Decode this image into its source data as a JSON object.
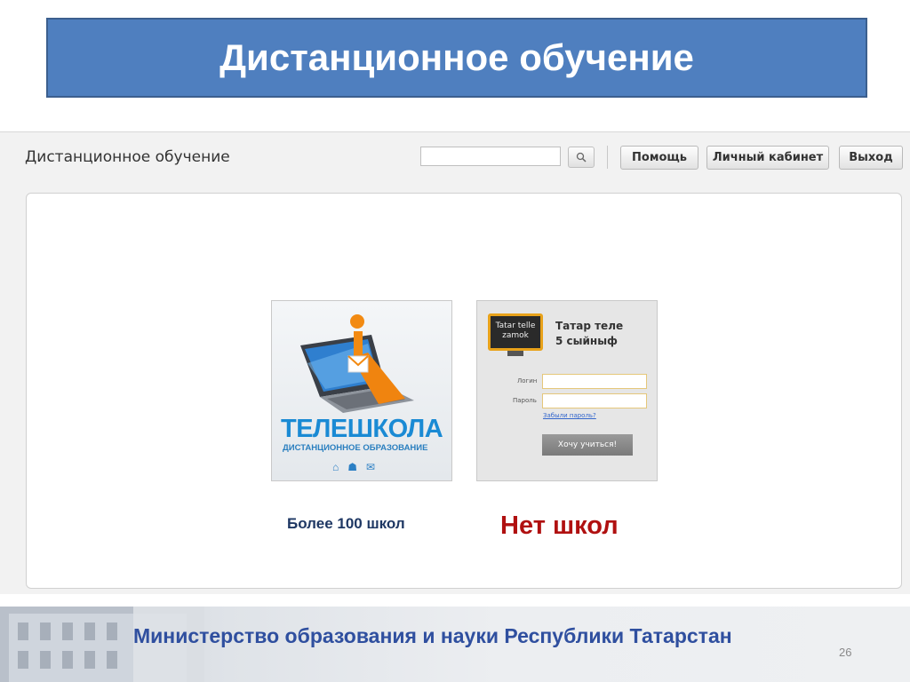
{
  "slide": {
    "title": "Дистанционное обучение",
    "page_number": "26"
  },
  "app": {
    "title": "Дистанционное обучение",
    "search": {
      "value": "",
      "placeholder": ""
    },
    "buttons": {
      "help": "Помощь",
      "cabinet": "Личный кабинет",
      "exit": "Выход"
    }
  },
  "cards": {
    "teleschool": {
      "brand": "ТЕЛЕШКОЛА",
      "subtitle": "ДИСТАНЦИОННОЕ ОБРАЗОВАНИЕ",
      "icons": [
        "home-icon",
        "sitemap-icon",
        "mail-icon"
      ]
    },
    "tatar": {
      "board_line1": "Tatar telle",
      "board_line2": "zamok",
      "title_line1": "Татар теле",
      "title_line2": "5 сыйныф",
      "login_label": "Логин",
      "password_label": "Пароль",
      "forgot_link": "Забыли пароль?",
      "submit": "Хочу учиться!"
    }
  },
  "captions": {
    "schools": "Более 100 школ",
    "no_schools": "Нет школ"
  },
  "footer": {
    "ministry": "Министерство образования и науки Республики Татарстан"
  },
  "colors": {
    "title_banner": "#4f7fbf",
    "no_schools": "#b01010",
    "schools": "#1f3864",
    "footer_text": "#2f4f9f"
  }
}
